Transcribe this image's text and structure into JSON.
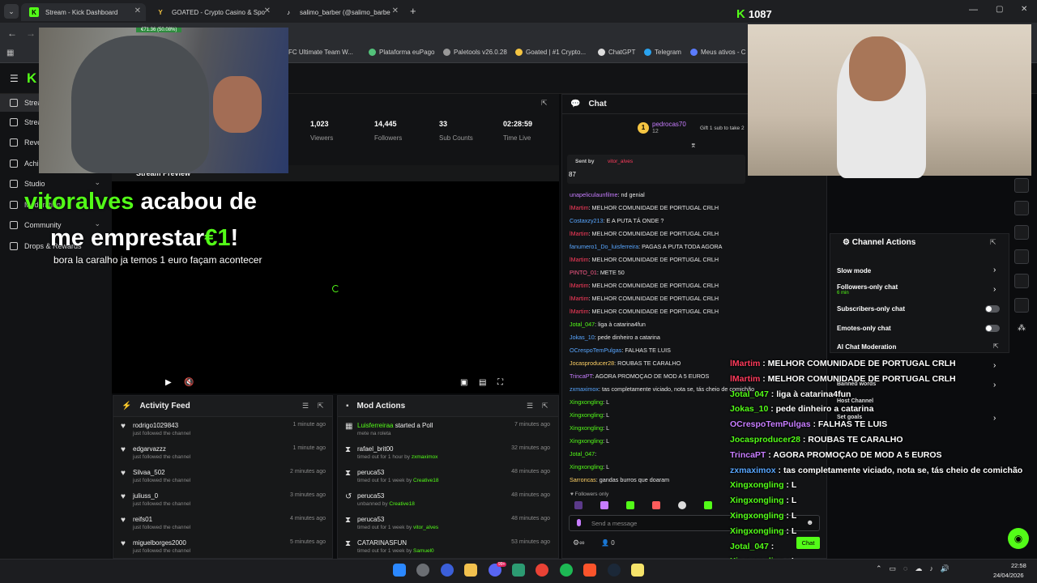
{
  "browser": {
    "tabs": [
      {
        "label": "Stream - Kick Dashboard",
        "active": true
      },
      {
        "label": "GOATED - Crypto Casino & Spo"
      },
      {
        "label": "salimo_barber (@salimo_barbe"
      }
    ],
    "new_tab": "+",
    "bookmarks": [
      "FC Ultimate Team W...",
      "Plataforma euPago",
      "Paletools v26.0.28",
      "Goated | #1 Crypto...",
      "ChatGPT",
      "Telegram",
      "Meus ativos - C"
    ]
  },
  "kick_count": "1087",
  "sidebar": {
    "items": [
      {
        "label": "Strea"
      },
      {
        "label": "Strea"
      },
      {
        "label": "Reve"
      },
      {
        "label": "Achi"
      },
      {
        "label": "Studio"
      },
      {
        "label": "Moderation"
      },
      {
        "label": "Community"
      },
      {
        "label": "Drops & Rewards"
      }
    ]
  },
  "stats": [
    {
      "value": "1,023",
      "label": "Viewers"
    },
    {
      "value": "14,445",
      "label": "Followers"
    },
    {
      "value": "33",
      "label": "Sub Counts"
    },
    {
      "value": "02:28:59",
      "label": "Time Live"
    }
  ],
  "preview": {
    "title": "Stream Preview",
    "overlay_name": "vitoralves",
    "overlay_line1": " acabou de",
    "overlay_line2": "me emprestar",
    "overlay_amount": "€1",
    "overlay_exclaim": "!",
    "overlay_sub": "bora la caralho ja temos 1 euro façam acontecer",
    "webcam_price": "€71.36 (50.08%)"
  },
  "activity": {
    "title": "Activity Feed",
    "rows": [
      {
        "name": "rodrigo1029843",
        "sub": "just followed the channel",
        "time": "1 minute ago"
      },
      {
        "name": "edgarvazzz",
        "sub": "just followed the channel",
        "time": "1 minute ago"
      },
      {
        "name": "Silvaa_502",
        "sub": "just followed the channel",
        "time": "2 minutes ago"
      },
      {
        "name": "juliuss_0",
        "sub": "just followed the channel",
        "time": "3 minutes ago"
      },
      {
        "name": "reifs01",
        "sub": "just followed the channel",
        "time": "4 minutes ago"
      },
      {
        "name": "miguelborges2000",
        "sub": "just followed the channel",
        "time": "5 minutes ago"
      }
    ]
  },
  "mod_actions": {
    "title": "Mod Actions",
    "rows": [
      {
        "name": "Luisferreiraa",
        "action": " started a Poll",
        "sub": "mete na roleta",
        "sub_by": "",
        "time": "7 minutes ago"
      },
      {
        "name": "rafael_brit00",
        "action": "",
        "sub": "timed out for 1 hour by ",
        "sub_by": "zxmaximox",
        "time": "32 minutes ago"
      },
      {
        "name": "peruca53",
        "action": "",
        "sub": "timed out for 1 week by ",
        "sub_by": "Creative18",
        "time": "48 minutes ago"
      },
      {
        "name": "peruca53",
        "action": "",
        "sub": "unbanned by ",
        "sub_by": "Creative18",
        "time": "48 minutes ago"
      },
      {
        "name": "peruca53",
        "action": "",
        "sub": "timed out for 1 week by ",
        "sub_by": "vitor_alves",
        "time": "48 minutes ago"
      },
      {
        "name": "CATARINASFUN",
        "action": "",
        "sub": "timed out for 1 week by ",
        "sub_by": "Samuel0",
        "time": "53 minutes ago"
      }
    ]
  },
  "chat": {
    "title": "Chat",
    "pinned_user": "pedrocas70",
    "pinned_count": "12",
    "pinned_text": "Gift 1 sub to take 2",
    "sent_by_label": "Sent by",
    "sent_by_user": "vitor_alves",
    "sent_value": "87",
    "messages": [
      {
        "user": "unapeliculaunfilme",
        "text": ": nd genial",
        "color": "#c77dff"
      },
      {
        "user": "lMartim",
        "text": ": MELHOR COMUNIDADE DE PORTUGAL CRLH",
        "color": "#ff3b5c"
      },
      {
        "user": "Costaxzy213",
        "text": ": E A PUTA TÁ ONDE ?",
        "color": "#58a6ff"
      },
      {
        "user": "lMartim",
        "text": ": MELHOR COMUNIDADE DE PORTUGAL CRLH",
        "color": "#ff3b5c"
      },
      {
        "user": "fanumero1_Do_luisferreira",
        "text": ": PAGAS A PUTA TODA AGORA",
        "color": "#58a6ff"
      },
      {
        "user": "lMartim",
        "text": ": MELHOR COMUNIDADE DE PORTUGAL CRLH",
        "color": "#ff3b5c"
      },
      {
        "user": "PINTO_01",
        "text": ": METE 50",
        "color": "#ff5c8a"
      },
      {
        "user": "lMartim",
        "text": ": MELHOR COMUNIDADE DE PORTUGAL CRLH",
        "color": "#ff3b5c"
      },
      {
        "user": "lMartim",
        "text": ": MELHOR COMUNIDADE DE PORTUGAL CRLH",
        "color": "#ff3b5c"
      },
      {
        "user": "lMartim",
        "text": ": MELHOR COMUNIDADE DE PORTUGAL CRLH",
        "color": "#ff3b5c"
      },
      {
        "user": "Jotal_047",
        "text": ": liga à catarina4fun",
        "color": "#53fc18"
      },
      {
        "user": "Jokas_10",
        "text": ": pede dinheiro a catarina",
        "color": "#58a6ff"
      },
      {
        "user": "OCrespoTemPulgas",
        "text": ": FALHAS TE LUIS",
        "color": "#58a6ff"
      },
      {
        "user": "Jocasproducer28",
        "text": ": ROUBAS TE CARALHO",
        "color": "#ffd166"
      },
      {
        "user": "TrincaPT",
        "text": ": AGORA PROMOÇAO DE MOD A 5 EUROS",
        "color": "#c77dff"
      },
      {
        "user": "zxmaximox",
        "text": ": tas completamente viciado, nota se, tás cheio de comichão",
        "color": "#58a6ff"
      },
      {
        "user": "Xingxongling",
        "text": ": L",
        "color": "#53fc18"
      },
      {
        "user": "Xingxongling",
        "text": ": L",
        "color": "#53fc18"
      },
      {
        "user": "Xingxongling",
        "text": ": L",
        "color": "#53fc18"
      },
      {
        "user": "Xingxongling",
        "text": ": L",
        "color": "#53fc18"
      },
      {
        "user": "Jotal_047",
        "text": ": ",
        "color": "#53fc18"
      },
      {
        "user": "Xingxongling",
        "text": ": L",
        "color": "#53fc18"
      },
      {
        "user": "Sarroncas",
        "text": ": gandas burros que doaram",
        "color": "#ffd166"
      }
    ],
    "followers_only": "Followers only",
    "input_placeholder": "Send a message",
    "viewers_count": "0",
    "chat_button": "Chat"
  },
  "channel_actions": {
    "title": "Channel Actions",
    "rows": [
      {
        "label": "Slow mode"
      },
      {
        "label": "Followers-only chat",
        "sub": "6 min"
      },
      {
        "label": "Subscribers-only chat"
      },
      {
        "label": "Emotes-only chat"
      },
      {
        "label": "AI Chat Moderation"
      },
      {
        "label": "Banned words"
      },
      {
        "label": "Host Channel"
      },
      {
        "label": "Set goals"
      }
    ]
  },
  "overlay_chat": [
    {
      "user": "lMartim",
      "text": " : MELHOR COMUNIDADE DE PORTUGAL CRLH",
      "color": "#ff3b5c"
    },
    {
      "user": "lMartim",
      "text": " : MELHOR COMUNIDADE DE PORTUGAL CRLH",
      "color": "#ff3b5c"
    },
    {
      "user": "Jotal_047",
      "text": " : liga à catarina4fun",
      "color": "#53fc18"
    },
    {
      "user": "Jokas_10",
      "text": " : pede dinheiro a catarina",
      "color": "#53fc18"
    },
    {
      "user": "OCrespoTemPulgas",
      "text": " : FALHAS TE LUIS",
      "color": "#c77dff"
    },
    {
      "user": "Jocasproducer28",
      "text": " : ROUBAS TE CARALHO",
      "color": "#53fc18"
    },
    {
      "user": "TrincaPT",
      "text": " : AGORA PROMOÇAO DE MOD A 5 EUROS",
      "color": "#c77dff"
    },
    {
      "user": "zxmaximox",
      "text": " : tas completamente viciado, nota se, tás cheio de comichão",
      "color": "#58a6ff"
    },
    {
      "user": "Xingxongling",
      "text": " : L",
      "color": "#53fc18"
    },
    {
      "user": "Xingxongling",
      "text": " : L",
      "color": "#53fc18"
    },
    {
      "user": "Xingxongling",
      "text": " : L",
      "color": "#53fc18"
    },
    {
      "user": "Xingxongling",
      "text": " : L",
      "color": "#53fc18"
    },
    {
      "user": "Jotal_047",
      "text": " : ",
      "color": "#53fc18"
    },
    {
      "user": "Xingxongling",
      "text": " : L",
      "color": "#53fc18"
    },
    {
      "user": "Sarroncas",
      "text": " : gandas burros que doaram",
      "color": "#53fc18"
    }
  ],
  "taskbar": {
    "time": "22:58",
    "date": "24/04/2026",
    "badge": "99+"
  },
  "colors": {
    "accent": "#53fc18",
    "bg": "#0b0c0e",
    "panel": "#171819"
  }
}
